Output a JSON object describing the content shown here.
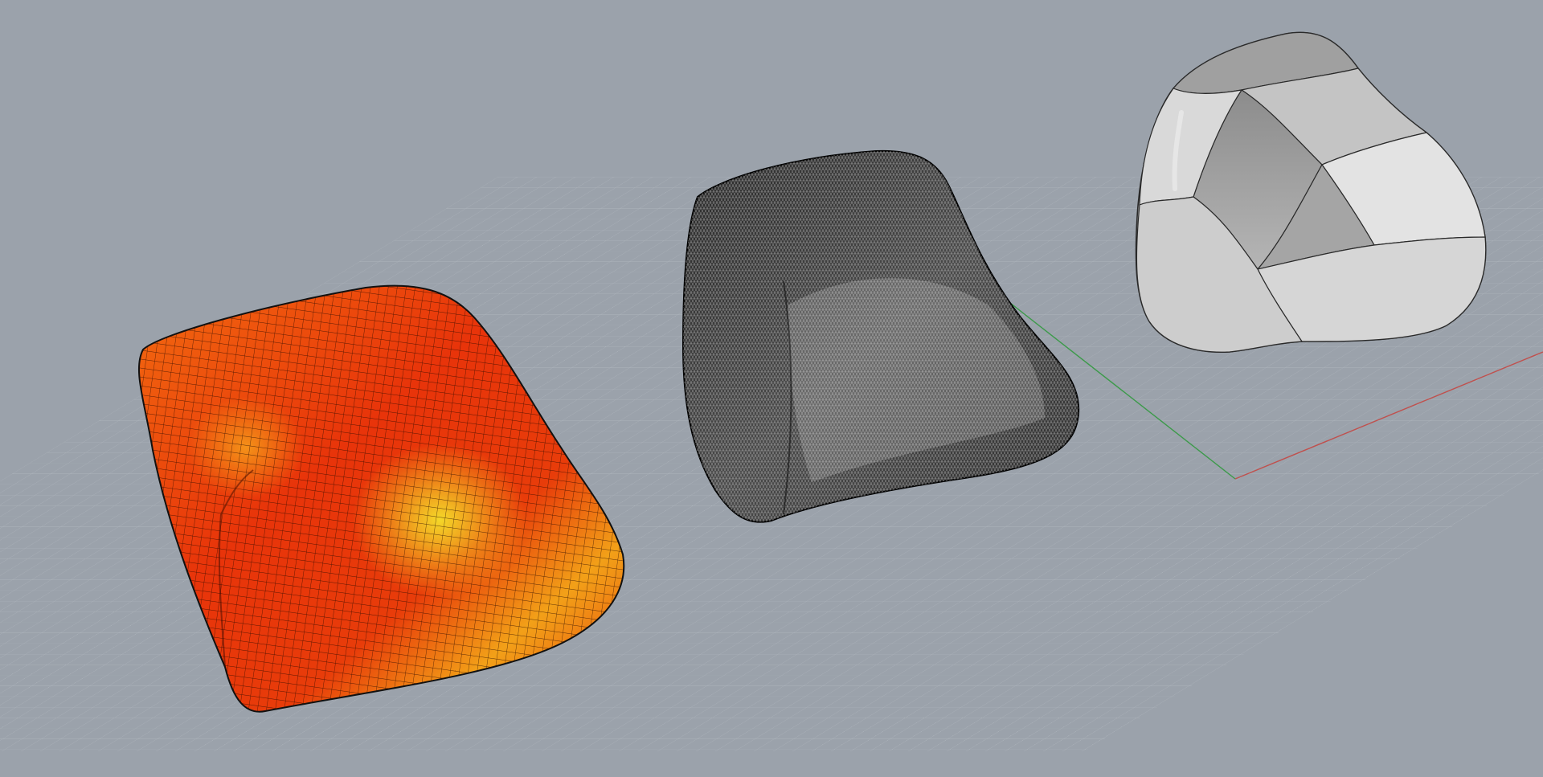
{
  "viewport": {
    "background": "#9ba2ab",
    "grid_minor_color": "#aab1b9",
    "grid_major_color": "#b9bfc6",
    "axis_x_color": "#c0504d",
    "axis_y_color": "#3c9a4a"
  },
  "objects": [
    {
      "kind": "surface",
      "display_mode": "zebra-heatmap",
      "colors": [
        "#e8340a",
        "#f26b10",
        "#f2d21a"
      ]
    },
    {
      "kind": "mesh",
      "display_mode": "wireframe",
      "colors": [
        "#1a1a1a",
        "#8a8a8a"
      ]
    },
    {
      "kind": "subd-polysurface",
      "display_mode": "shaded",
      "colors": [
        "#bcbcbc",
        "#dcdcdc",
        "#7c7c7c"
      ]
    }
  ]
}
